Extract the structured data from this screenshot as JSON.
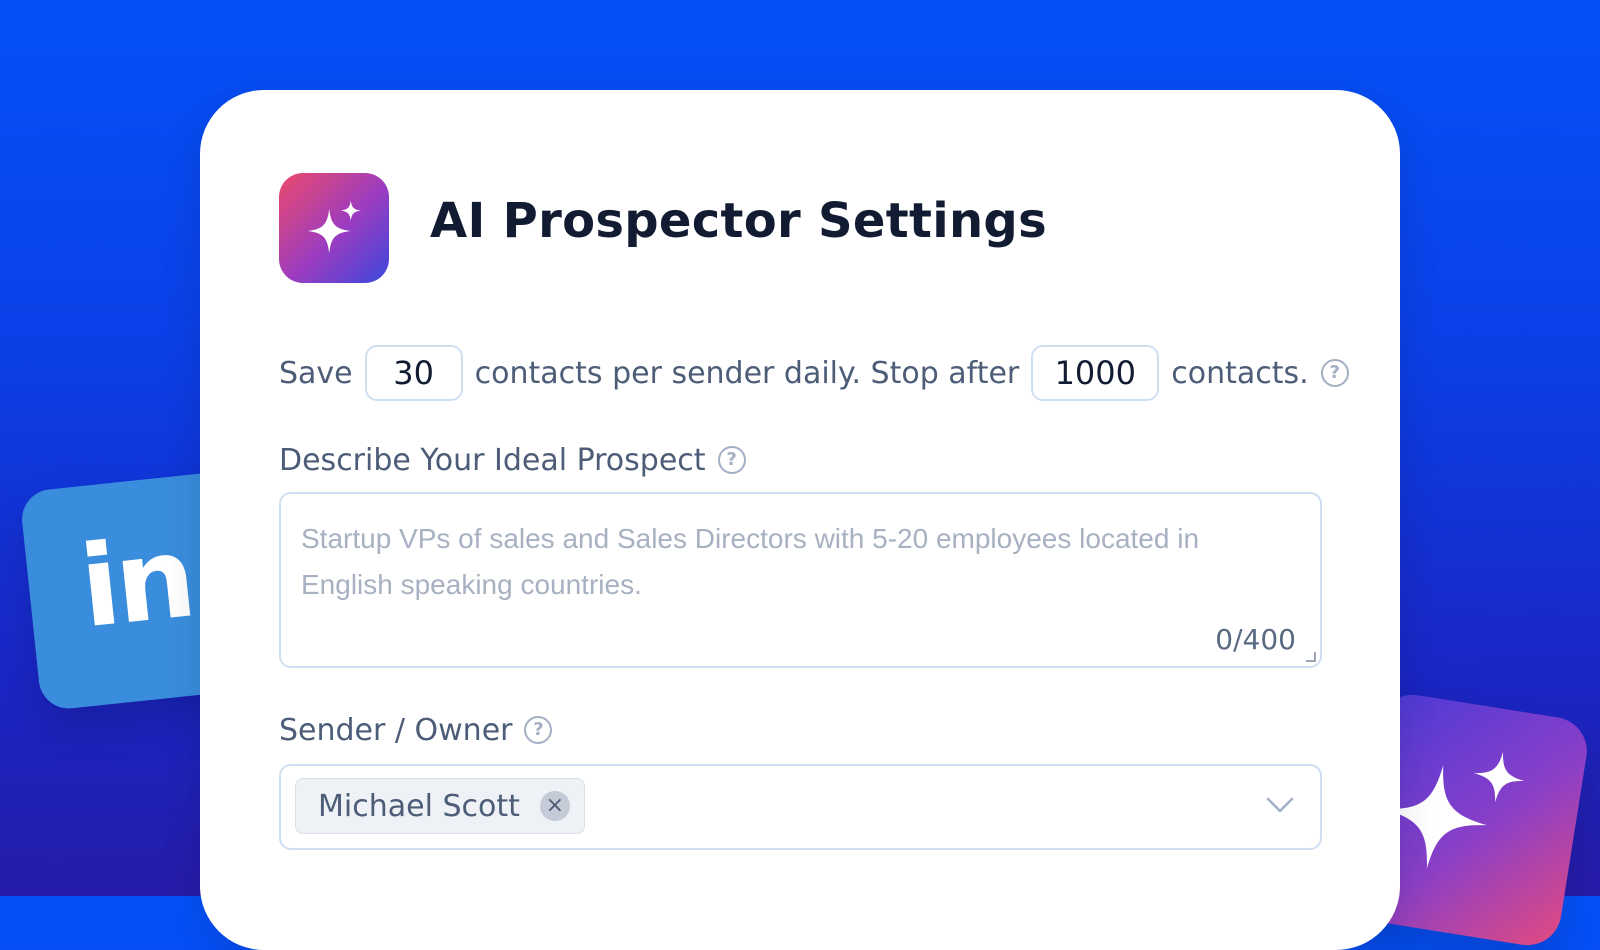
{
  "background": {
    "linkedin_tile": {
      "text": "in",
      "color": "#3a8ddd"
    },
    "ai_tile": {
      "icon": "sparkle-icon"
    }
  },
  "header": {
    "app_icon": "sparkle-icon",
    "title": "AI Prospector Settings"
  },
  "limits": {
    "prefix": "Save",
    "daily_value": "30",
    "middle": "contacts per sender daily. Stop after",
    "total_value": "1000",
    "suffix": "contacts.",
    "help_icon": "?"
  },
  "prospect": {
    "label": "Describe Your Ideal Prospect",
    "help_icon": "?",
    "placeholder": "Startup VPs of sales and Sales Directors with 5-20 employees located in English speaking countries.",
    "counter": "0/400"
  },
  "sender": {
    "label": "Sender / Owner",
    "help_icon": "?",
    "selected": "Michael Scott",
    "remove_glyph": "×"
  },
  "colors": {
    "accent_gradient_start": "#ec4a6b",
    "accent_gradient_end": "#3b48dc",
    "background": "#0b3fe6",
    "border": "#cfdff2"
  }
}
